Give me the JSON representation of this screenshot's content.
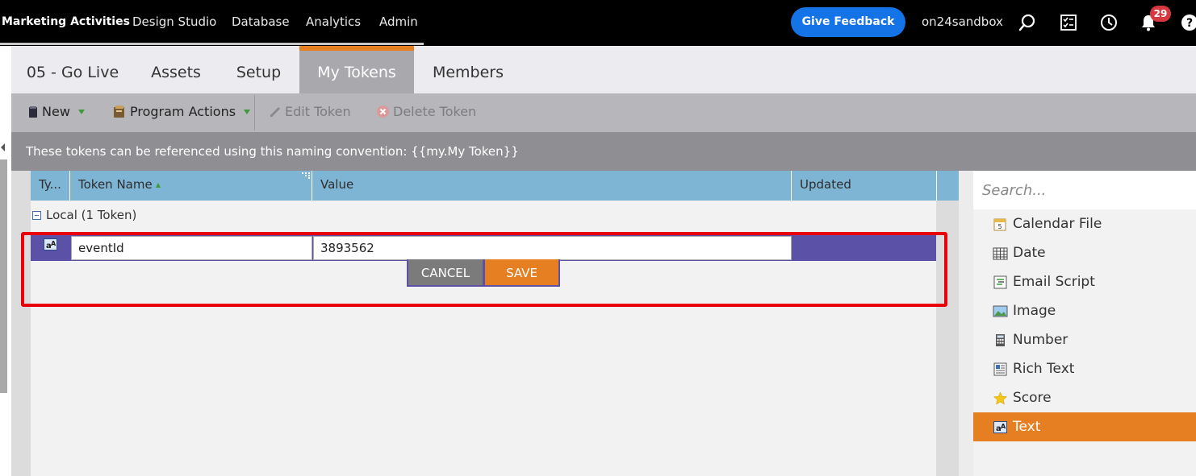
{
  "topnav": {
    "items": [
      "Marketing Activities",
      "Design Studio",
      "Database",
      "Analytics",
      "Admin"
    ],
    "feedback_label": "Give Feedback",
    "workspace": "on24sandbox",
    "notification_count": "29"
  },
  "tabs": [
    "05 - Go Live",
    "Assets",
    "Setup",
    "My Tokens",
    "Members"
  ],
  "toolbar": {
    "new_label": "New",
    "program_actions_label": "Program Actions",
    "edit_token_label": "Edit Token",
    "delete_token_label": "Delete Token"
  },
  "info_text": "These tokens can be referenced using this naming convention: {{my.My Token}}",
  "grid": {
    "columns": [
      "Ty...",
      "Token Name",
      "Value",
      "Updated"
    ],
    "group_label": "Local (1 Token)",
    "edit_row": {
      "token_name": "eventId",
      "value": "3893562"
    },
    "cancel_label": "CANCEL",
    "save_label": "SAVE"
  },
  "token_panel": {
    "search_placeholder": "Search...",
    "items": [
      {
        "label": "Calendar File",
        "icon": "calendar-icon"
      },
      {
        "label": "Date",
        "icon": "date-grid-icon"
      },
      {
        "label": "Email Script",
        "icon": "script-icon"
      },
      {
        "label": "Image",
        "icon": "image-icon"
      },
      {
        "label": "Number",
        "icon": "calculator-icon"
      },
      {
        "label": "Rich Text",
        "icon": "rich-text-icon"
      },
      {
        "label": "Score",
        "icon": "star-icon"
      },
      {
        "label": "Text",
        "icon": "text-icon"
      }
    ],
    "selected": "Text"
  },
  "colors": {
    "accent_orange": "#e67e22",
    "feedback_blue": "#1473e6",
    "grid_header": "#7fb5d4",
    "edit_row": "#5b52a8",
    "highlight_red": "#e8000b"
  }
}
